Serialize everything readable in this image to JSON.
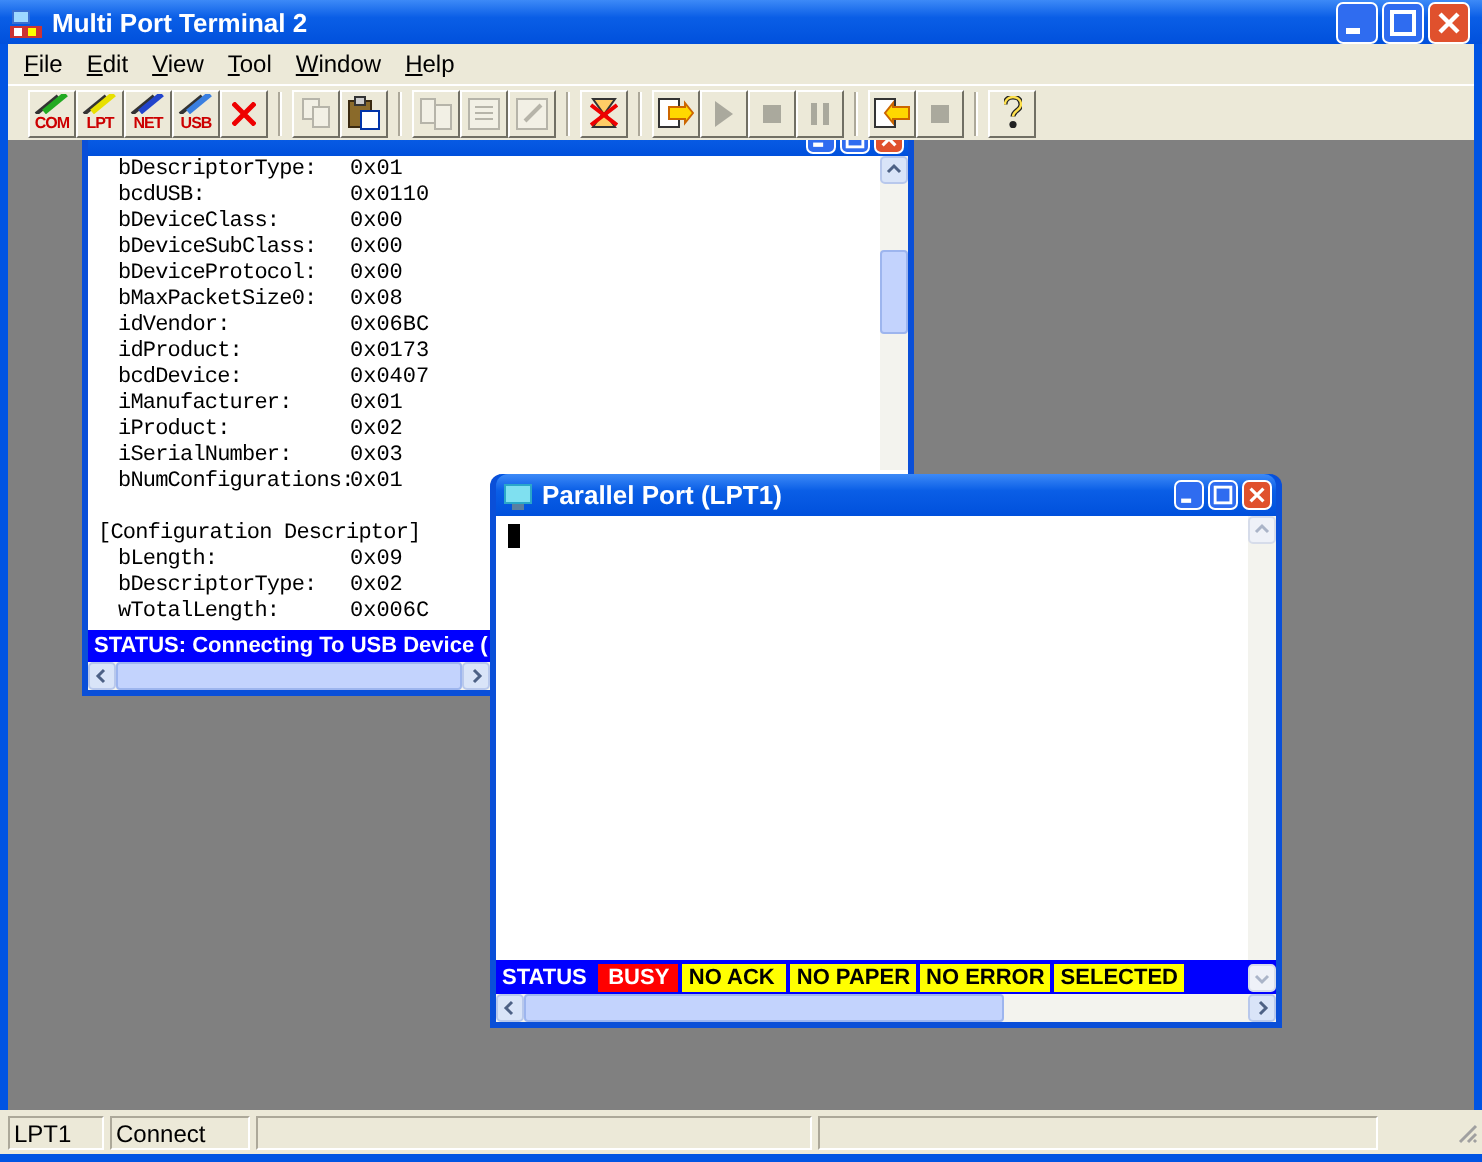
{
  "window": {
    "title": "Multi Port Terminal 2"
  },
  "menu": [
    {
      "label": "File"
    },
    {
      "label": "Edit"
    },
    {
      "label": "View"
    },
    {
      "label": "Tool"
    },
    {
      "label": "Window"
    },
    {
      "label": "Help"
    }
  ],
  "toolbar": [
    [
      {
        "kind": "port",
        "label": "COM",
        "disabled": false
      },
      {
        "kind": "port",
        "label": "LPT",
        "disabled": false
      },
      {
        "kind": "port",
        "label": "NET",
        "disabled": false
      },
      {
        "kind": "port",
        "label": "USB",
        "disabled": false
      },
      {
        "kind": "tool",
        "disabled": false
      }
    ],
    [
      {
        "kind": "tool",
        "disabled": true
      },
      {
        "kind": "tool",
        "disabled": false
      }
    ],
    [
      {
        "kind": "tool",
        "disabled": true
      },
      {
        "kind": "tool",
        "disabled": true
      },
      {
        "kind": "tool",
        "disabled": true
      }
    ],
    [
      {
        "kind": "tool",
        "disabled": false
      }
    ],
    [
      {
        "kind": "tool",
        "disabled": false
      },
      {
        "kind": "tool",
        "disabled": true
      },
      {
        "kind": "tool",
        "disabled": true
      },
      {
        "kind": "tool",
        "disabled": true
      }
    ],
    [
      {
        "kind": "tool",
        "disabled": false
      },
      {
        "kind": "tool",
        "disabled": true
      }
    ],
    [
      {
        "kind": "tool",
        "disabled": false
      }
    ]
  ],
  "usb_window": {
    "lines": [
      {
        "kind": "field",
        "label": "bDescriptorType:",
        "value": "0x01"
      },
      {
        "kind": "field",
        "label": "bcdUSB:",
        "value": "0x0110"
      },
      {
        "kind": "field",
        "label": "bDeviceClass:",
        "value": "0x00"
      },
      {
        "kind": "field",
        "label": "bDeviceSubClass:",
        "value": "0x00"
      },
      {
        "kind": "field",
        "label": "bDeviceProtocol:",
        "value": "0x00"
      },
      {
        "kind": "field",
        "label": "bMaxPacketSize0:",
        "value": "0x08"
      },
      {
        "kind": "field",
        "label": "idVendor:",
        "value": "0x06BC"
      },
      {
        "kind": "field",
        "label": "idProduct:",
        "value": "0x0173"
      },
      {
        "kind": "field",
        "label": "bcdDevice:",
        "value": "0x0407"
      },
      {
        "kind": "field",
        "label": "iManufacturer:",
        "value": "0x01"
      },
      {
        "kind": "field",
        "label": "iProduct:",
        "value": "0x02"
      },
      {
        "kind": "field",
        "label": "iSerialNumber:",
        "value": "0x03"
      },
      {
        "kind": "field",
        "label": "bNumConfigurations:",
        "value": "0x01"
      },
      {
        "kind": "blank"
      },
      {
        "kind": "heading",
        "label": "[Configuration Descriptor]"
      },
      {
        "kind": "field",
        "label": "bLength:",
        "value": "0x09"
      },
      {
        "kind": "field",
        "label": "bDescriptorType:",
        "value": "0x02"
      },
      {
        "kind": "field",
        "label": "wTotalLength:",
        "value": "0x006C"
      }
    ],
    "status": "STATUS: Connecting To USB Device ("
  },
  "lpt_window": {
    "title": "Parallel Port (LPT1)",
    "status_items": [
      {
        "kind": "label",
        "label": "STATUS"
      },
      {
        "kind": "indicator",
        "label": "BUSY",
        "color": "#ff0000"
      },
      {
        "kind": "indicator",
        "label": "NO ACK",
        "color": "#ffff00"
      },
      {
        "kind": "indicator",
        "label": "NO PAPER",
        "color": "#ffff00"
      },
      {
        "kind": "indicator",
        "label": "NO ERROR",
        "color": "#ffff00"
      },
      {
        "kind": "indicator",
        "label": "SELECTED",
        "color": "#ffff00"
      }
    ]
  },
  "status_bar": [
    {
      "text": "LPT1"
    },
    {
      "text": "Connect"
    }
  ]
}
